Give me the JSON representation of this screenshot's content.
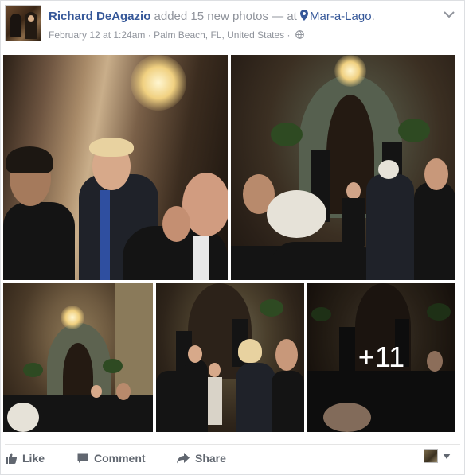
{
  "post": {
    "author": "Richard DeAgazio",
    "action_text": "added 15 new photos",
    "separator": "—",
    "at_word": "at",
    "location_name": "Mar-a-Lago",
    "location_suffix": ".",
    "timestamp": "February 12 at 1:24am",
    "dot": "·",
    "place": "Palm Beach, FL, United States",
    "privacy_icon": "globe-icon",
    "menu_icon": "chevron-down-icon"
  },
  "photos": {
    "count_shown": 5,
    "more_overlay": "+11"
  },
  "actions": {
    "like": "Like",
    "comment": "Comment",
    "share": "Share"
  },
  "colors": {
    "link": "#365899",
    "muted": "#90949c",
    "action": "#616770"
  }
}
